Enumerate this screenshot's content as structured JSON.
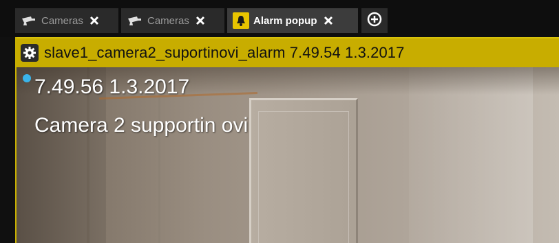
{
  "tabs": [
    {
      "label": "Cameras",
      "icon": "security-camera-icon",
      "active": false
    },
    {
      "label": "Cameras",
      "icon": "security-camera-icon",
      "active": false
    },
    {
      "label": "Alarm popup",
      "icon": "bell-icon",
      "active": true
    }
  ],
  "add_tab_icon": "plus-circle-icon",
  "popup": {
    "title": "slave1_camera2_suportinovi_alarm 7.49.54  1.3.2017",
    "settings_icon": "gear-icon",
    "overlay_time": "7.49.56  1.3.2017",
    "overlay_camera": "Camera 2 supportin ovi",
    "status_dot_color": "#3ab4ea",
    "accent_color": "#c8ad00"
  }
}
